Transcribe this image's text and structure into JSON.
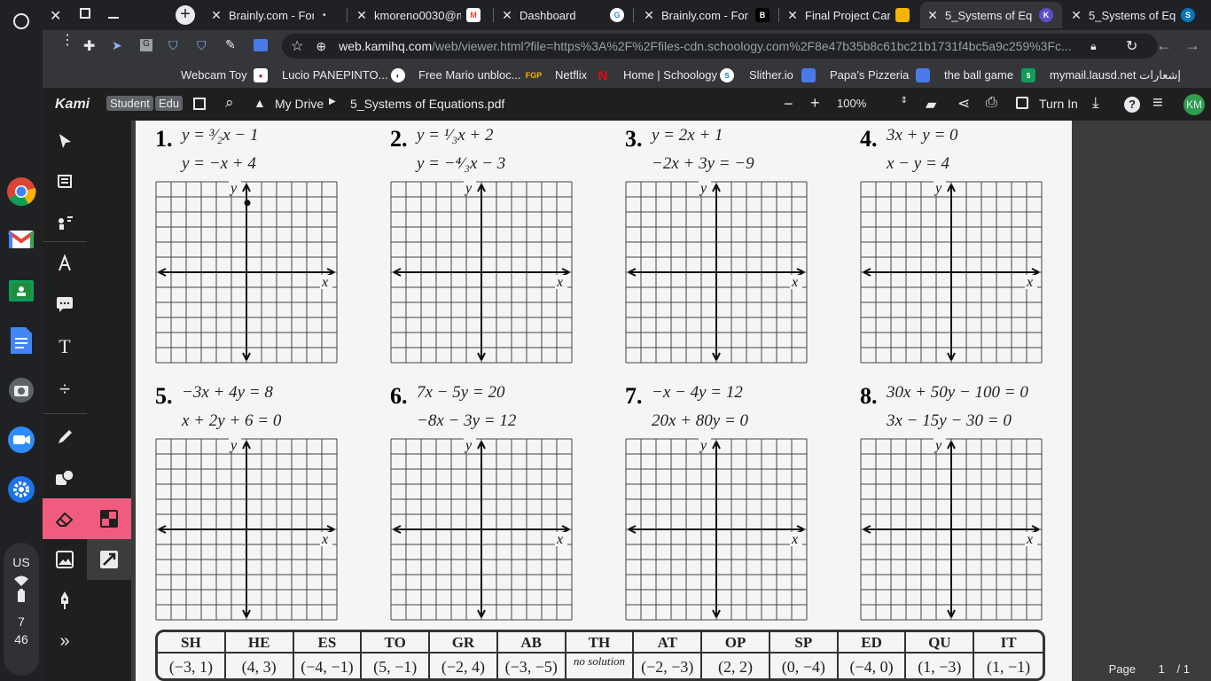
{
  "shelf": {
    "apps": [
      "launcher-icon",
      "chrome-icon",
      "gmail-icon",
      "classroom-icon",
      "docs-icon",
      "camera-icon",
      "zoom-icon",
      "settings-icon"
    ],
    "status": {
      "lang": "US",
      "time_hour": "7",
      "time_min": "46"
    }
  },
  "tabs": [
    {
      "title": "Brainly.com - For",
      "fav": "brainly"
    },
    {
      "title": "kmoreno0030@m",
      "fav": "gmail"
    },
    {
      "title": "Dashboard",
      "fav": "google"
    },
    {
      "title": "Brainly.com - For",
      "fav": "brainly"
    },
    {
      "title": "Final Project Cam",
      "fav": "slides"
    },
    {
      "title": "5_Systems of Eq",
      "fav": "kami",
      "active": true
    },
    {
      "title": "5_Systems of Eq",
      "fav": "schoology"
    }
  ],
  "omnibox": {
    "host": "web.kamihq.com",
    "path": "/web/viewer.html?file=https%3A%2F%2Ffiles-cdn.schoology.com%2F8e47b35b8c61bc21b1731f4bc5a9c259%3Fc..."
  },
  "bookmarks": [
    "Webcam Toy",
    "Lucio PANEPINTO...",
    "Free Mario unbloc...",
    "Netflix",
    "Home | Schoology",
    "Slither.io",
    "Papa's Pizzeria",
    "the ball game",
    "mymail.lausd.net إشعارات"
  ],
  "kami": {
    "logo": "Kami",
    "badge_student": "Student",
    "badge_edu": "Edu",
    "drive": "My Drive",
    "filename": "5_Systems of Equations.pdf",
    "zoom": "100%",
    "turn_in": "Turn In",
    "avatar": "KM"
  },
  "problems": [
    {
      "num": "1.",
      "eq1": "y = ³⁄₂x − 1",
      "eq2": "y = −x + 4"
    },
    {
      "num": "2.",
      "eq1": "y = ¹⁄₃x + 2",
      "eq2": "y = −⁴⁄₃x − 3"
    },
    {
      "num": "3.",
      "eq1": "y = 2x + 1",
      "eq2": "−2x + 3y = −9"
    },
    {
      "num": "4.",
      "eq1": "3x + y = 0",
      "eq2": "x − y = 4"
    },
    {
      "num": "5.",
      "eq1": "−3x + 4y = 8",
      "eq2": "x + 2y + 6 = 0"
    },
    {
      "num": "6.",
      "eq1": "7x − 5y = 20",
      "eq2": "−8x − 3y = 12"
    },
    {
      "num": "7.",
      "eq1": "−x − 4y = 12",
      "eq2": "20x + 80y = 0"
    },
    {
      "num": "8.",
      "eq1": "30x + 50y − 100 = 0",
      "eq2": "3x − 15y − 30 = 0"
    }
  ],
  "axis": {
    "x": "x",
    "y": "y"
  },
  "answers": [
    {
      "code": "SH",
      "val": "(−3, 1)"
    },
    {
      "code": "HE",
      "val": "(4, 3)"
    },
    {
      "code": "ES",
      "val": "(−4, −1)"
    },
    {
      "code": "TO",
      "val": "(5, −1)"
    },
    {
      "code": "GR",
      "val": "(−2, 4)"
    },
    {
      "code": "AB",
      "val": "(−3, −5)"
    },
    {
      "code": "TH",
      "val": "no solution"
    },
    {
      "code": "AT",
      "val": "(−2, −3)"
    },
    {
      "code": "OP",
      "val": "(2, 2)"
    },
    {
      "code": "SP",
      "val": "(0, −4)"
    },
    {
      "code": "ED",
      "val": "(−4, 0)"
    },
    {
      "code": "QU",
      "val": "(1, −3)"
    },
    {
      "code": "IT",
      "val": "(1, −1)"
    }
  ],
  "page": {
    "label": "Page",
    "current": "1",
    "total": "/ 1"
  }
}
